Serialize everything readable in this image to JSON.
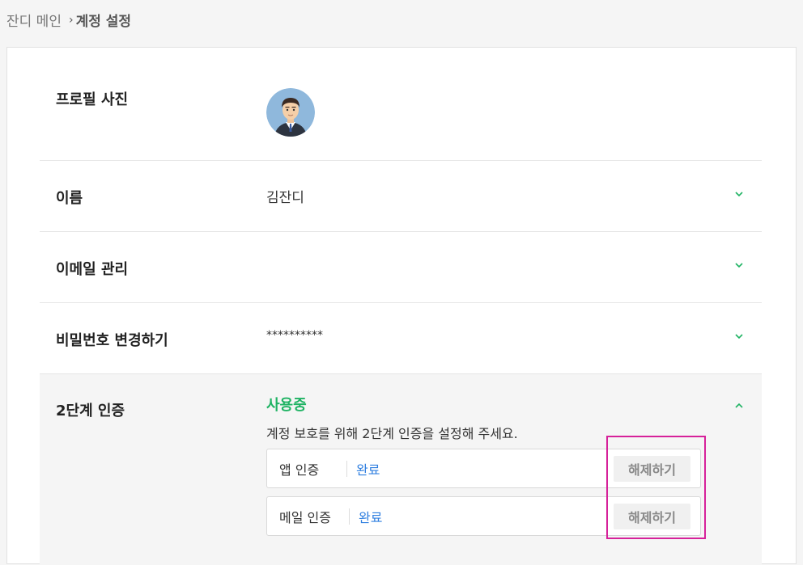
{
  "breadcrumb": {
    "parent": "잔디 메인",
    "separator": "›",
    "current": "계정 설정"
  },
  "profile": {
    "label": "프로필 사진",
    "avatar_icon": "user-avatar-icon"
  },
  "name": {
    "label": "이름",
    "value": "김잔디"
  },
  "email": {
    "label": "이메일 관리"
  },
  "password": {
    "label": "비밀번호 변경하기",
    "value": "**********"
  },
  "two_factor": {
    "label": "2단계 인증",
    "status": "사용중",
    "description": "계정 보호를 위해 2단계 인증을 설정해 주세요.",
    "methods": [
      {
        "name": "앱 인증",
        "state": "완료",
        "button": "해제하기"
      },
      {
        "name": "메일 인증",
        "state": "완료",
        "button": "해제하기"
      }
    ]
  },
  "colors": {
    "accent_green": "#1fb363",
    "link_blue": "#2f7fe0",
    "highlight": "#d6219a"
  }
}
